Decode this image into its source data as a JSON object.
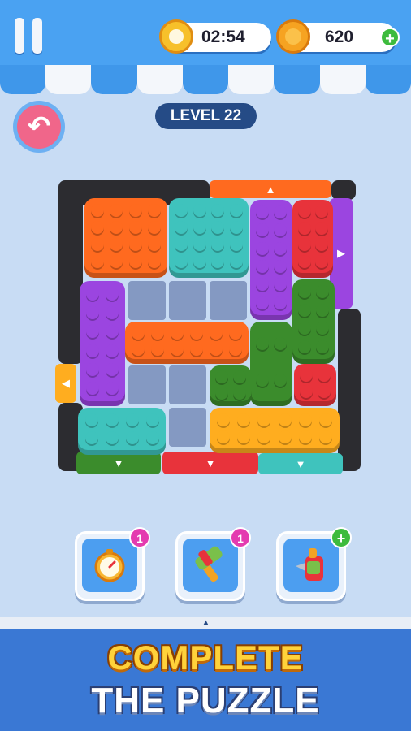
{
  "hud": {
    "timer": "02:54",
    "coins": "620",
    "add_coins": "+"
  },
  "level": {
    "label": "LEVEL 22"
  },
  "colors": {
    "orange": "#ff6a1f",
    "teal": "#3fc3bd",
    "purple": "#9b45e0",
    "red": "#e8333b",
    "green": "#3b8c2c",
    "yellow": "#ffad1f"
  },
  "board": {
    "gates": [
      {
        "color": "orange",
        "arrow": "▲"
      },
      {
        "color": "purple",
        "arrow": "▶"
      },
      {
        "color": "yellow",
        "arrow": "◀"
      },
      {
        "color": "green",
        "arrow": "▼"
      },
      {
        "color": "red",
        "arrow": "▼"
      },
      {
        "color": "teal",
        "arrow": "▼"
      }
    ],
    "blocks": [
      {
        "color": "orange",
        "size": "2x2"
      },
      {
        "color": "teal",
        "size": "2x2"
      },
      {
        "color": "purple",
        "size": "1x3"
      },
      {
        "color": "red",
        "size": "1x2"
      },
      {
        "color": "purple",
        "size": "1x3"
      },
      {
        "color": "orange",
        "size": "3x1"
      },
      {
        "color": "green",
        "size": "1x2"
      },
      {
        "color": "green",
        "size": "L"
      },
      {
        "color": "red",
        "size": "1x1"
      },
      {
        "color": "teal",
        "size": "2x1"
      },
      {
        "color": "yellow",
        "size": "3x1"
      }
    ]
  },
  "boosters": [
    {
      "name": "timer-freeze",
      "icon": "stopwatch-icon",
      "count": "1"
    },
    {
      "name": "hammer",
      "icon": "hammer-icon",
      "count": "1"
    },
    {
      "name": "drill",
      "icon": "drill-icon",
      "count": "+"
    }
  ],
  "banner": {
    "line1": "COMPLETE",
    "line2": "THE PUZZLE"
  }
}
